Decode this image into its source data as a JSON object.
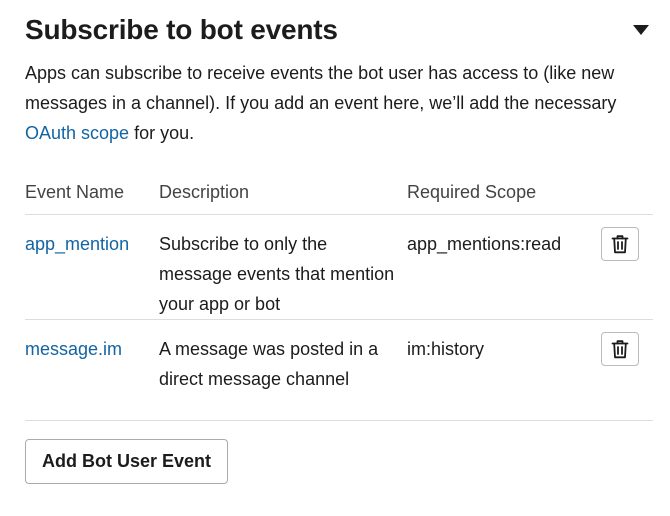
{
  "section": {
    "title": "Subscribe to bot events",
    "intro_before_link": "Apps can subscribe to receive events the bot user has access to (like new messages in a channel). If you add an event here, we’ll add the necessary ",
    "intro_link": "OAuth scope",
    "intro_after_link": " for you."
  },
  "table": {
    "headers": {
      "name": "Event Name",
      "description": "Description",
      "scope": "Required Scope"
    },
    "rows": [
      {
        "name": "app_mention",
        "description": "Subscribe to only the message events that mention your app or bot",
        "scope": "app_mentions:read"
      },
      {
        "name": "message.im",
        "description": "A message was posted in a direct message channel",
        "scope": "im:history"
      }
    ]
  },
  "actions": {
    "add_label": "Add Bot User Event"
  },
  "icons": {
    "collapse": "caret-down-icon",
    "delete": "trash-icon"
  },
  "colors": {
    "link": "#1264a3",
    "text": "#1d1c1d",
    "border": "#dddddd"
  }
}
